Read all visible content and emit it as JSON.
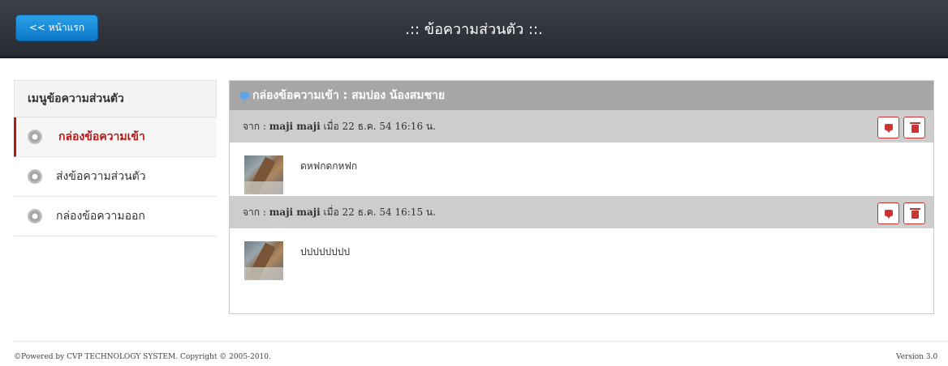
{
  "header": {
    "home_label": "<< หน้าแรก",
    "title": ".:: ข้อความส่วนตัว ::."
  },
  "sidebar": {
    "title": "เมนูข้อความส่วนตัว",
    "items": [
      {
        "label": "กล่องข้อความเข้า",
        "active": true
      },
      {
        "label": "ส่งข้อความส่วนตัว",
        "active": false
      },
      {
        "label": "กล่องข้อความออก",
        "active": false
      }
    ]
  },
  "inbox": {
    "title": "กล่องข้อความเข้า : สมปอง น้องสมชาย",
    "messages": [
      {
        "from_prefix": "จาก :",
        "sender": "maji maji",
        "date_text": "เมื่อ 22 ธ.ค. 54 16:16 น.",
        "body": "ดหฟกดกหฟก"
      },
      {
        "from_prefix": "จาก :",
        "sender": "maji maji",
        "date_text": "เมื่อ 22 ธ.ค. 54 16:15 น.",
        "body": "ปปปปปปปป"
      }
    ]
  },
  "footer": {
    "copyright": "©Powered by CVP TECHNOLOGY SYSTEM. Copyright © 2005-2010.",
    "version": "Version 3.0"
  },
  "colors": {
    "accent": "#b31b1b",
    "header_bg": "#2f343b",
    "home_button": "#1b8ad8"
  }
}
